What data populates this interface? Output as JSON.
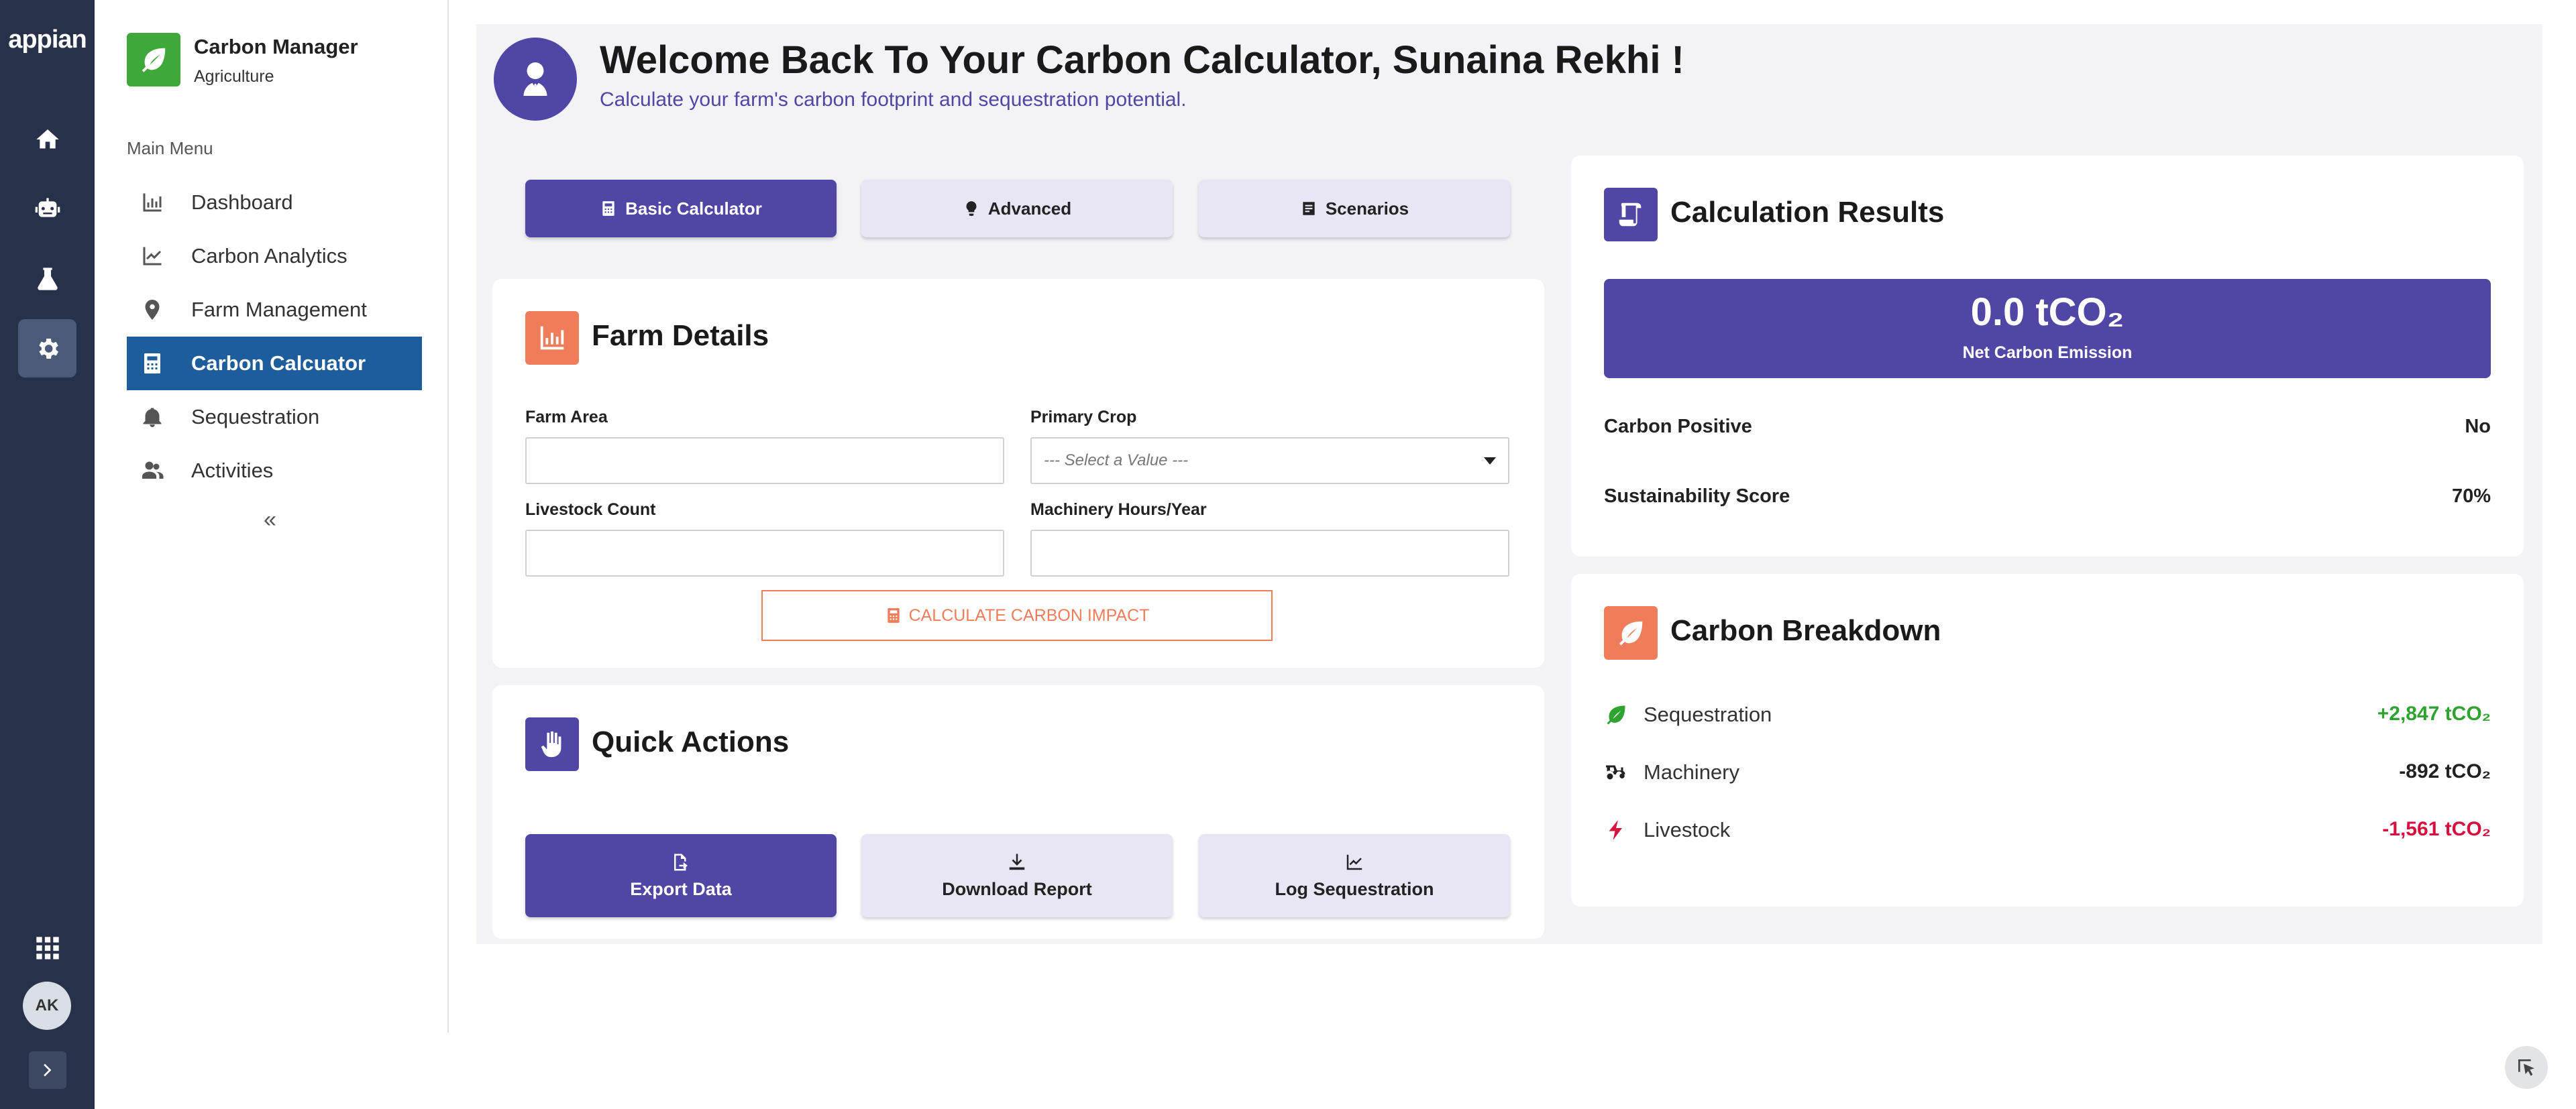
{
  "rail": {
    "logo": "appian",
    "avatar_initials": "AK"
  },
  "sidebar": {
    "app_name": "Carbon Manager",
    "app_sub": "Agriculture",
    "menu_heading": "Main Menu",
    "items": [
      {
        "label": "Dashboard",
        "icon": "bar-chart-icon"
      },
      {
        "label": "Carbon Analytics",
        "icon": "line-chart-icon"
      },
      {
        "label": "Farm Management",
        "icon": "map-pin-icon"
      },
      {
        "label": "Carbon Calcuator",
        "icon": "calculator-icon",
        "active": true
      },
      {
        "label": "Sequestration",
        "icon": "bell-icon"
      },
      {
        "label": "Activities",
        "icon": "users-icon"
      }
    ],
    "collapse_glyph": "«"
  },
  "header": {
    "title": "Welcome Back To Your Carbon Calculator, Sunaina Rekhi !",
    "subtitle": "Calculate your farm's carbon footprint and sequestration potential."
  },
  "tabs": [
    {
      "label": "Basic Calculator",
      "icon": "calculator-icon"
    },
    {
      "label": "Advanced",
      "icon": "lightbulb-icon"
    },
    {
      "label": "Scenarios",
      "icon": "document-icon"
    }
  ],
  "farm_details": {
    "title": "Farm Details",
    "farm_area_label": "Farm Area",
    "primary_crop_label": "Primary Crop",
    "primary_crop_placeholder": "--- Select a Value ---",
    "livestock_label": "Livestock Count",
    "machinery_label": "Machinery Hours/Year",
    "calculate_button": "CALCULATE CARBON IMPACT"
  },
  "quick_actions": {
    "title": "Quick Actions",
    "buttons": [
      {
        "label": "Export Data",
        "icon": "export-icon"
      },
      {
        "label": "Download Report",
        "icon": "download-icon"
      },
      {
        "label": "Log Sequestration",
        "icon": "chart-icon"
      }
    ]
  },
  "results": {
    "title": "Calculation Results",
    "net_value": "0.0 tCO₂",
    "net_label": "Net Carbon Emission",
    "rows": [
      {
        "label": "Carbon Positive",
        "value": "No"
      },
      {
        "label": "Sustainability Score",
        "value": "70%"
      }
    ]
  },
  "breakdown": {
    "title": "Carbon Breakdown",
    "items": [
      {
        "label": "Sequestration",
        "value": "+2,847 tCO₂",
        "color": "#2fa32f",
        "icon": "leaf-icon"
      },
      {
        "label": "Machinery",
        "value": "-892 tCO₂",
        "color": "#222222",
        "icon": "tractor-icon"
      },
      {
        "label": "Livestock",
        "value": "-1,561 tCO₂",
        "color": "#d6113f",
        "icon": "bolt-icon"
      }
    ]
  },
  "colors": {
    "primary": "#4f46a5",
    "accent_orange": "#ef7d5a",
    "nav_active": "#1d5d9b",
    "rail": "#27324a",
    "brand_green": "#3fa83a"
  }
}
